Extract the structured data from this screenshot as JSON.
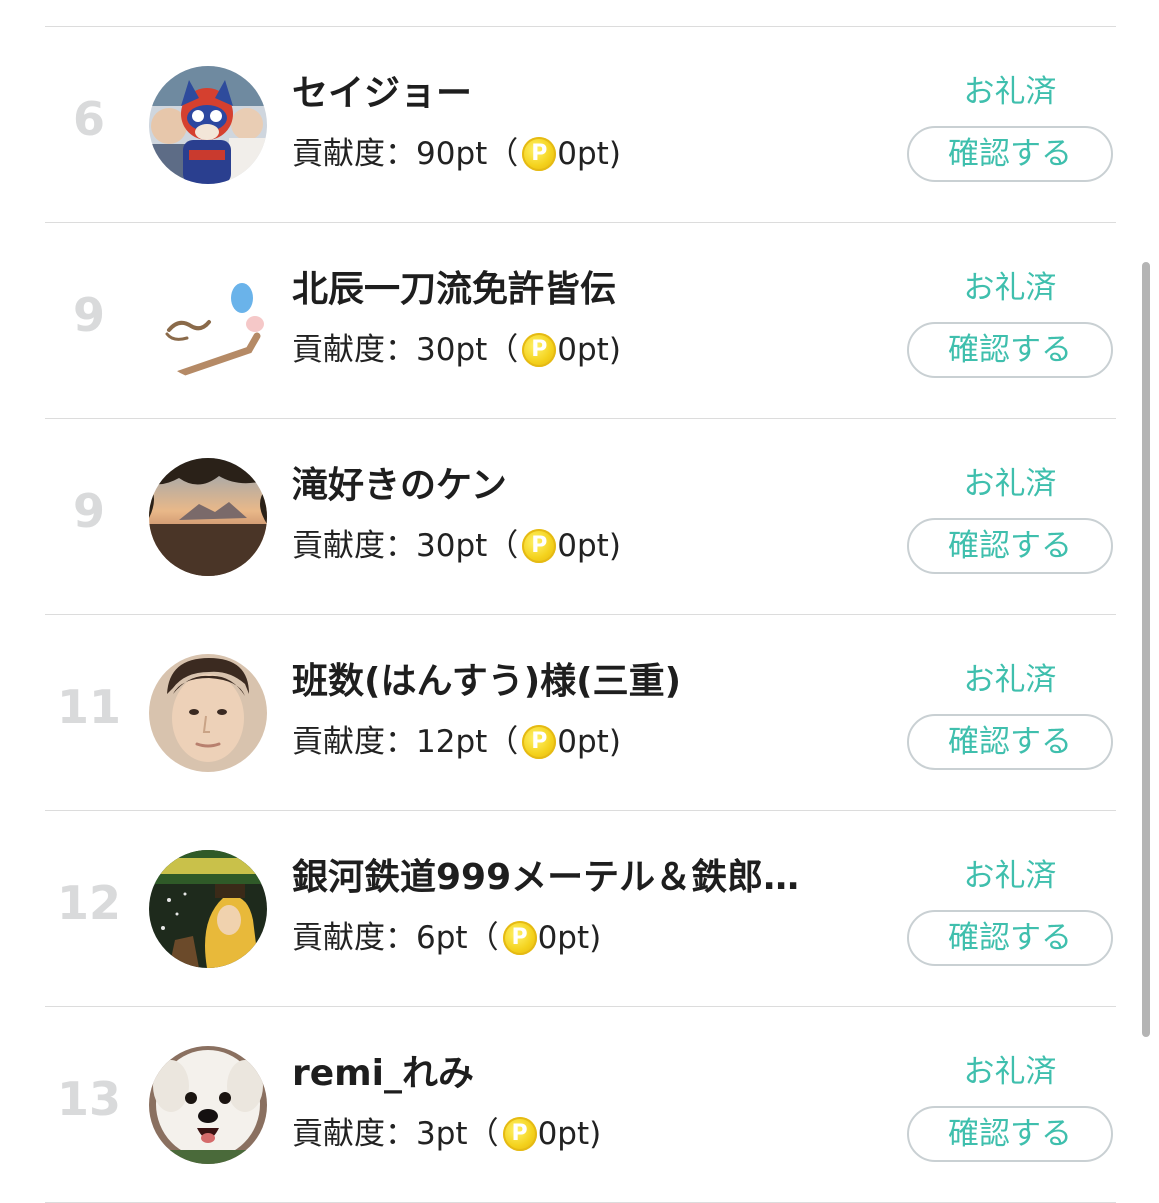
{
  "ranking": {
    "contrib_label": "貢献度：",
    "thanks_status": "お礼済",
    "confirm_label": "確認する",
    "coin_symbol": "P",
    "open_paren": "（",
    "close_paren": ")",
    "entries": [
      {
        "rank": "6",
        "name": "セイジョー",
        "contrib": "90pt",
        "coin_pts": "0pt"
      },
      {
        "rank": "9",
        "name": "北辰一刀流免許皆伝",
        "contrib": "30pt",
        "coin_pts": "0pt"
      },
      {
        "rank": "9",
        "name": "滝好きのケン",
        "contrib": "30pt",
        "coin_pts": "0pt"
      },
      {
        "rank": "11",
        "name": "班数(はんすう)様(三重)",
        "contrib": "12pt",
        "coin_pts": "0pt"
      },
      {
        "rank": "12",
        "name": "銀河鉄道999メーテル＆鉄郎…",
        "contrib": "6pt",
        "coin_pts": "0pt"
      },
      {
        "rank": "13",
        "name": "remi_れみ",
        "contrib": "3pt",
        "coin_pts": "0pt"
      }
    ]
  },
  "colors": {
    "accent": "#3fbfad",
    "rank": "#d9dadb",
    "divider": "#dcdcdc",
    "button_border": "#c9d0d3",
    "coin": "#f4d21d"
  }
}
